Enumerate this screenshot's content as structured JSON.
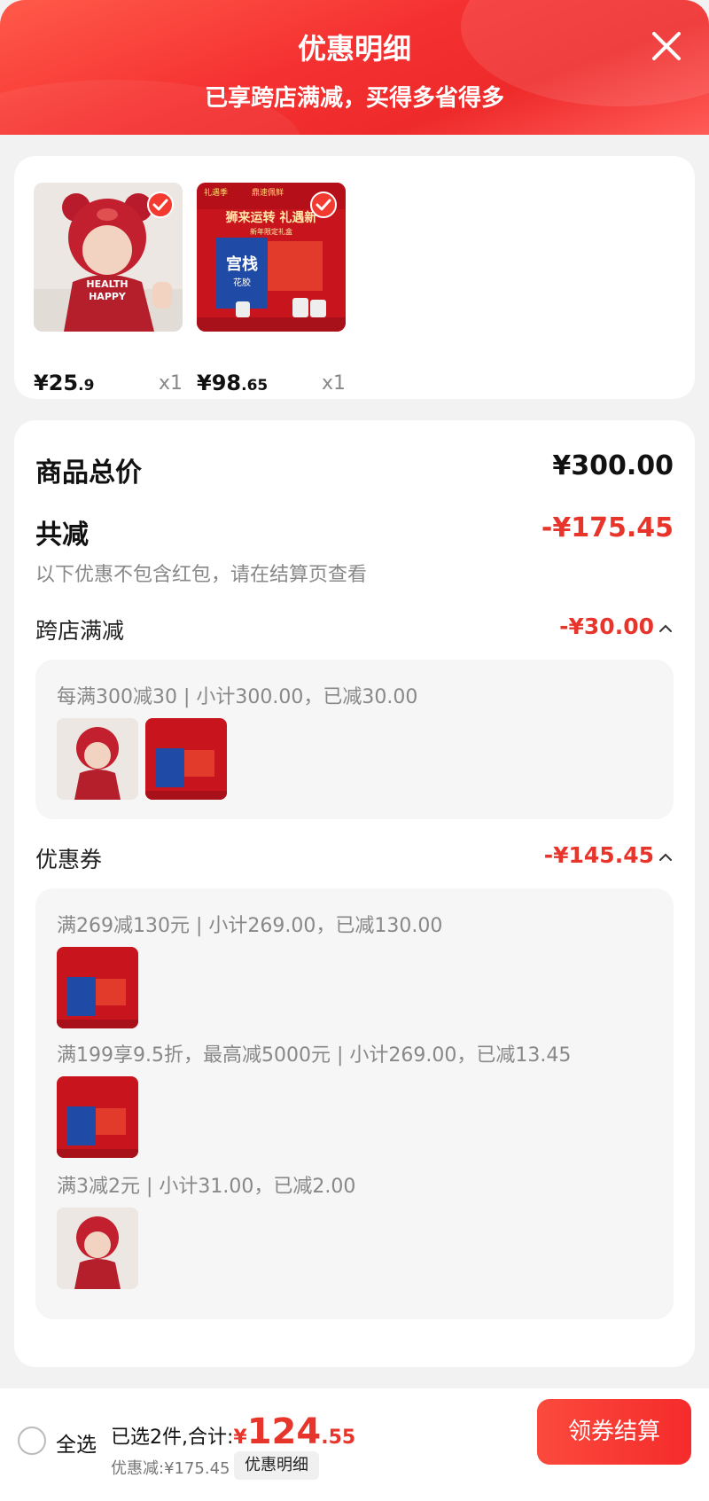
{
  "header": {
    "title": "优惠明细",
    "subtitle": "已享跨店满减，买得多省得多",
    "close_icon": "close-icon"
  },
  "products": [
    {
      "name": "baby-romper",
      "price_int": "¥25",
      "price_dec": ".9",
      "qty": "x1",
      "checked": true
    },
    {
      "name": "gift-box",
      "price_int": "¥98",
      "price_dec": ".65",
      "qty": "x1",
      "checked": true
    }
  ],
  "product_image_text": {
    "romper_lines": [
      "HEALTH",
      "HAPPY"
    ],
    "gift_banner": "狮来运转 礼遇新",
    "gift_tag_top_left": "礼遇季",
    "gift_tag_top_mid": "鼎速佩鲜",
    "gift_brand": "宫栈",
    "gift_sub": "花胶",
    "gift_small": "新年限定礼盒"
  },
  "totals": {
    "goods_total_label": "商品总价",
    "goods_total_value": "¥300.00",
    "total_reduce_label": "共减",
    "total_reduce_value": "-¥175.45",
    "note": "以下优惠不包含红包，请在结算页查看"
  },
  "cross_store": {
    "label": "跨店满减",
    "value": "-¥30.00",
    "rule": "每满300减30 | 小计300.00，已减30.00"
  },
  "coupons": {
    "label": "优惠券",
    "value": "-¥145.45",
    "rules": [
      "满269减130元 | 小计269.00，已减130.00",
      "满199享9.5折，最高减5000元 | 小计269.00，已减13.45",
      "满3减2元 | 小计31.00，已减2.00"
    ]
  },
  "footer": {
    "select_all": "全选",
    "selected_text": "已选2件,合计:",
    "yen": "¥",
    "total_int": "124",
    "total_dec": ".55",
    "discount_line": "优惠减:¥175.45",
    "detail_label": "优惠明细",
    "checkout_label": "领券结算"
  },
  "colors": {
    "accent": "#e8352c",
    "header_red": "#f53030",
    "check_red": "#f23a30"
  }
}
